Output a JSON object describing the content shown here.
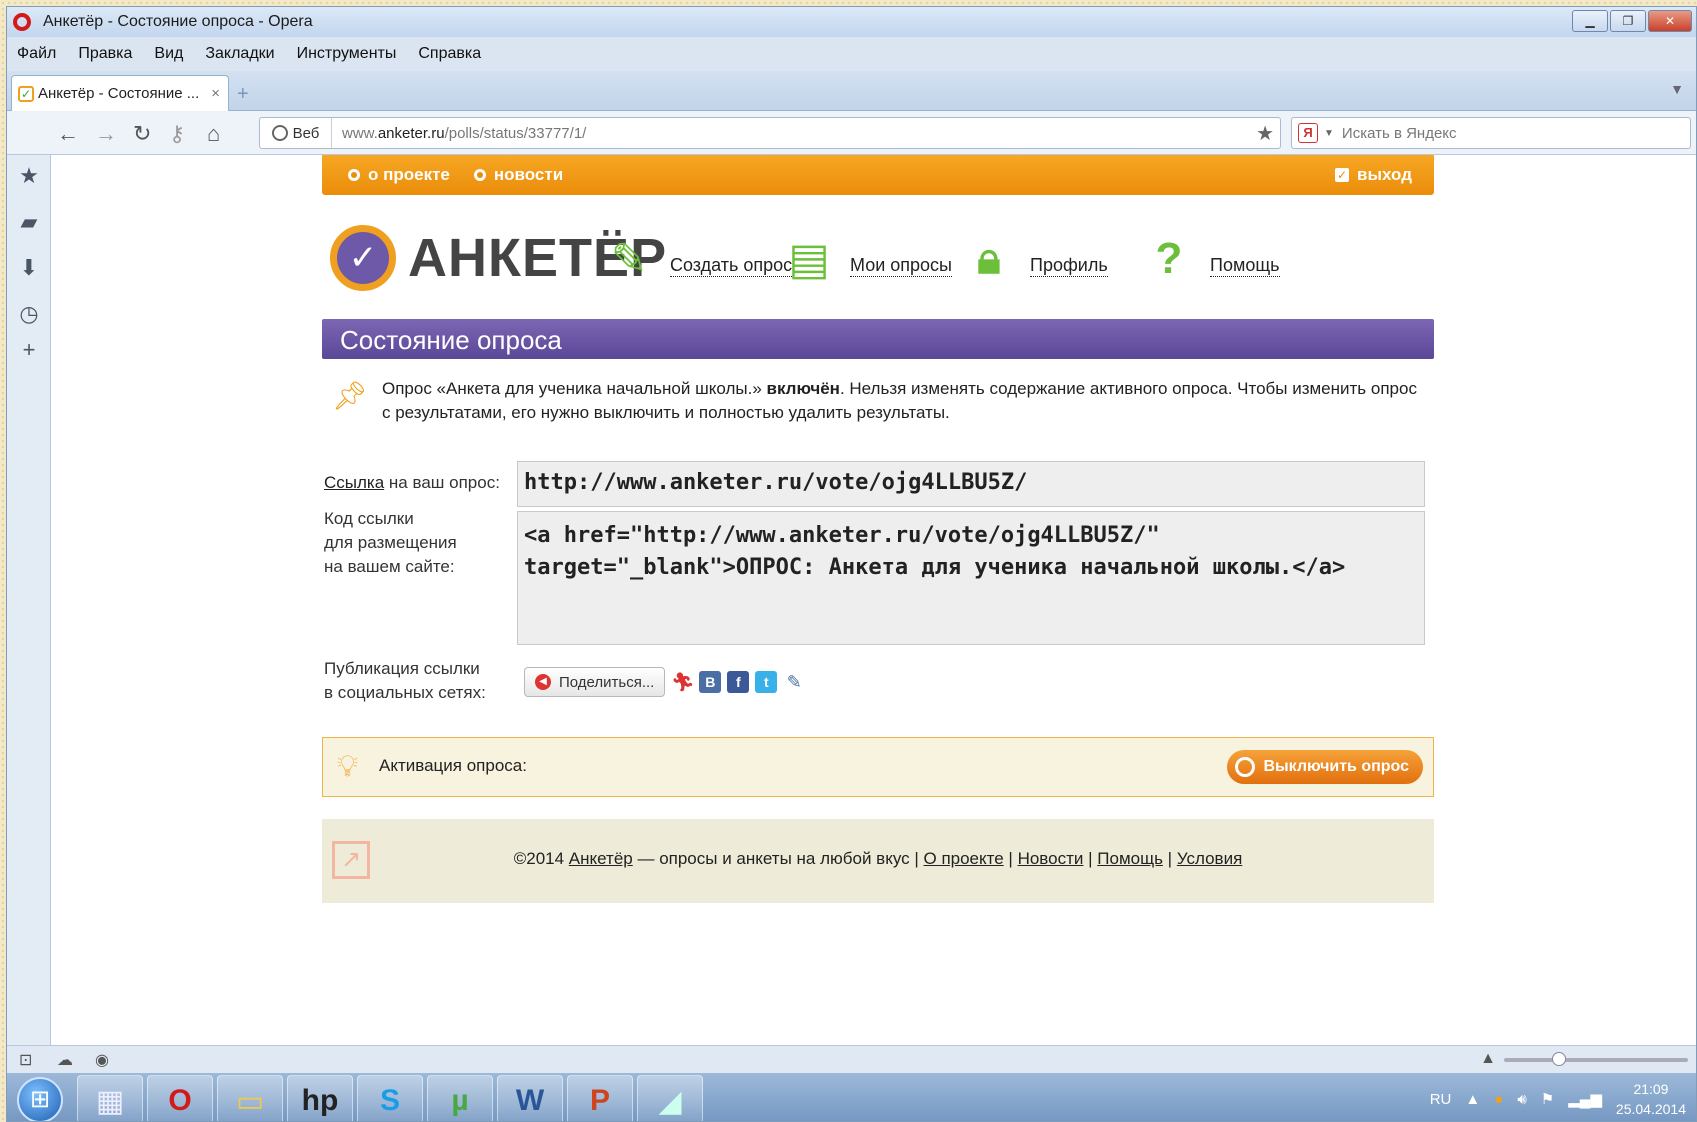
{
  "window": {
    "title": "Анкетёр - Состояние опроса - Opera"
  },
  "menu": [
    "Файл",
    "Правка",
    "Вид",
    "Закладки",
    "Инструменты",
    "Справка"
  ],
  "tab": {
    "label": "Анкетёр - Состояние ...",
    "close": "×",
    "new": "+"
  },
  "nav": {
    "web_label": "Веб",
    "url_prefix": "www.",
    "url_domain": "anketer.ru",
    "url_path": "/polls/status/33777/1/",
    "search_placeholder": "Искать в Яндекс",
    "search_engine": "Я"
  },
  "site": {
    "top_links": {
      "about": "о проекте",
      "news": "новости",
      "logout": "выход"
    },
    "logo_text": "АНКЕТЁР",
    "header_nav": [
      {
        "label": "Создать опрос",
        "icon": "create-poll-icon"
      },
      {
        "label": "Мои опросы",
        "icon": "my-polls-icon"
      },
      {
        "label": "Профиль",
        "icon": "profile-lock-icon"
      },
      {
        "label": "Помощь",
        "icon": "help-icon"
      }
    ],
    "section_title": "Состояние опроса",
    "notice": {
      "part1": "Опрос «Анкета для ученика начальной школы.» ",
      "bold": "включён",
      "part2": ". Нельзя изменять содержание активного опроса. Чтобы изменить опрос с результатами, его нужно выключить и полностью удалить результаты."
    },
    "link_label_u": "Ссылка",
    "link_label_rest": " на ваш опрос:",
    "link_value": "http://www.anketer.ru/vote/ojg4LLBU5Z/",
    "code_label_1": "Код ссылки",
    "code_label_2": "для размещения",
    "code_label_3": "на вашем сайте:",
    "code_value": "<a href=\"http://www.anketer.ru/vote/ojg4LLBU5Z/\" target=\"_blank\">ОПРОС: Анкета для ученика начальной школы.</a>",
    "social_label_1": "Публикация ссылки",
    "social_label_2": "в социальных сетях:",
    "share_button": "Поделиться...",
    "social_icons": [
      "В",
      "f",
      "t"
    ],
    "activation_label": "Активация опроса:",
    "disable_button": "Выключить опрос",
    "footer": {
      "copyright": "©2014 ",
      "brand": "Анкетёр",
      "tagline": " — опросы и анкеты на любой вкус | ",
      "links": [
        "О проекте",
        "Новости",
        "Помощь",
        "Условия"
      ]
    }
  },
  "taskbar": {
    "lang": "RU",
    "time": "21:09",
    "date": "25.04.2014"
  },
  "colors": {
    "orange": "#f39a17",
    "purple": "#6a56a6",
    "green": "#6cbf3a"
  }
}
